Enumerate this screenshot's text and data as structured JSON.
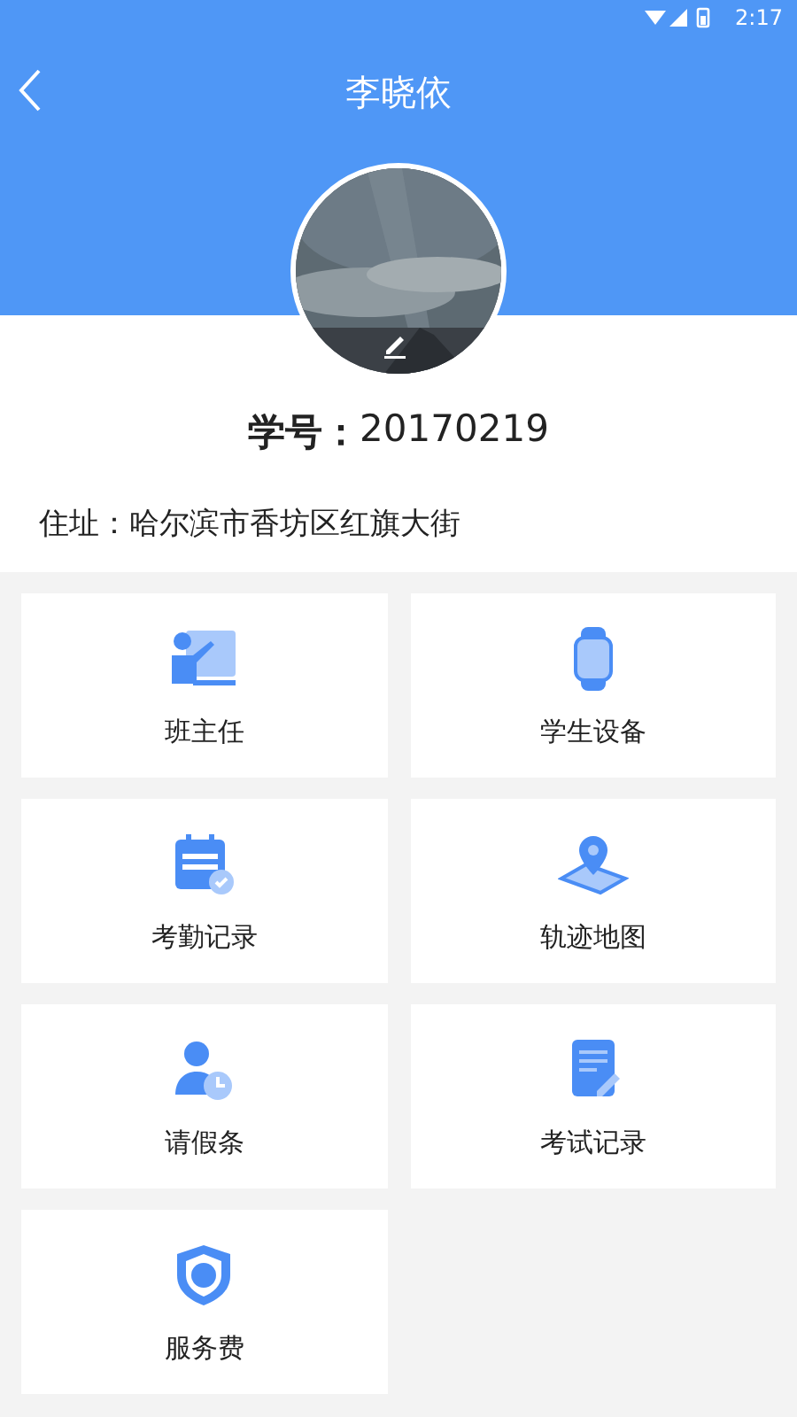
{
  "status_bar": {
    "time": "2:17"
  },
  "header": {
    "title": "李晓依"
  },
  "profile": {
    "student_id_label": "学号：",
    "student_id": "20170219",
    "address": "住址：哈尔滨市香坊区红旗大街"
  },
  "menu": [
    {
      "kind": "teacher",
      "label": "班主任"
    },
    {
      "kind": "watch",
      "label": "学生设备"
    },
    {
      "kind": "calendar",
      "label": "考勤记录"
    },
    {
      "kind": "map",
      "label": "轨迹地图"
    },
    {
      "kind": "leave",
      "label": "请假条"
    },
    {
      "kind": "exam",
      "label": "考试记录"
    },
    {
      "kind": "shield",
      "label": "服务费"
    }
  ]
}
